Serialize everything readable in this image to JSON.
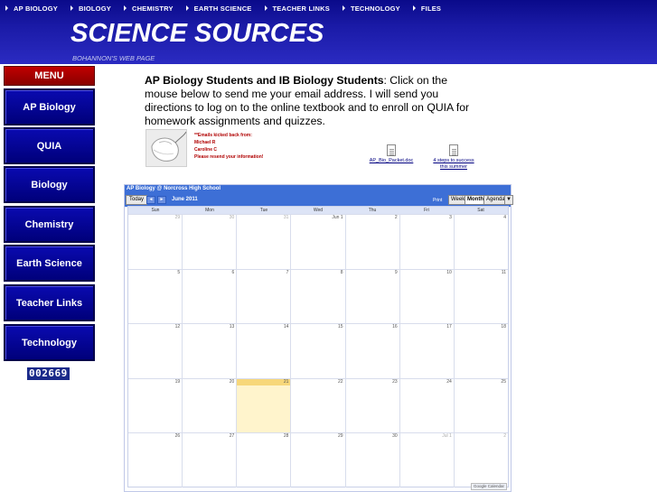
{
  "topnav": [
    {
      "label": "AP BIOLOGY"
    },
    {
      "label": "BIOLOGY"
    },
    {
      "label": "CHEMISTRY"
    },
    {
      "label": "EARTH SCIENCE"
    },
    {
      "label": "TEACHER LINKS"
    },
    {
      "label": "TECHNOLOGY"
    },
    {
      "label": "FILES"
    }
  ],
  "header": {
    "title": "SCIENCE SOURCES",
    "subtitle": "BOHANNON'S WEB PAGE"
  },
  "sidebar": {
    "menu_label": "MENU",
    "items": [
      {
        "label": "AP Biology"
      },
      {
        "label": "QUIA"
      },
      {
        "label": "Biology"
      },
      {
        "label": "Chemistry"
      },
      {
        "label": "Earth Science"
      },
      {
        "label": "Teacher Links"
      },
      {
        "label": "Technology"
      }
    ],
    "counter": "002669"
  },
  "main": {
    "intro_bold": "AP Biology Students and IB Biology Students",
    "intro_rest": ": Click on the mouse below to send me your email address. I will send you directions to log on to the online textbook and to enroll on QUIA for homework assignments and quizzes.",
    "emails_lines": [
      "**Emails kicked back from:",
      "Michael R",
      "Caroline C",
      "Please resend your information!"
    ],
    "docs": [
      {
        "label": "AP_Bio_Packet.doc"
      },
      {
        "label_line1": "4 steps to success",
        "label_line2": "this summer"
      }
    ]
  },
  "calendar": {
    "title": "AP Biology @ Norcross High School",
    "today_label": "Today",
    "prev_label": "◄",
    "next_label": "►",
    "month_label": "June 2011",
    "print_label": "Print",
    "views": [
      "Week",
      "Month",
      "Agenda"
    ],
    "dropdown_label": "▼",
    "days_of_week": [
      "Sun",
      "Mon",
      "Tue",
      "Wed",
      "Thu",
      "Fri",
      "Sat"
    ],
    "weeks": [
      [
        "29",
        "30",
        "31",
        "Jun 1",
        "2",
        "3",
        "4"
      ],
      [
        "5",
        "6",
        "7",
        "8",
        "9",
        "10",
        "11"
      ],
      [
        "12",
        "13",
        "14",
        "15",
        "16",
        "17",
        "18"
      ],
      [
        "19",
        "20",
        "21",
        "22",
        "23",
        "24",
        "25"
      ],
      [
        "26",
        "27",
        "28",
        "29",
        "30",
        "Jul 1",
        "2"
      ]
    ],
    "badge": "Google Calendar",
    "colors": {
      "header": "#3d6fd6",
      "today": "#fff4cc"
    }
  }
}
